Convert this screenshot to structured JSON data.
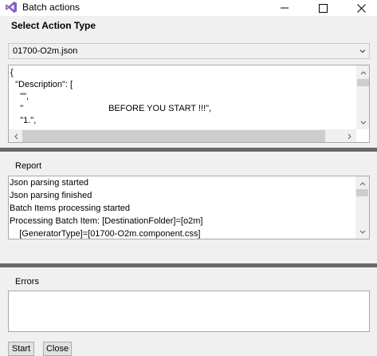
{
  "window": {
    "title": "Batch actions",
    "app_icon": "visual-studio-icon",
    "controls": [
      "minimize-icon",
      "maximize-icon",
      "close-icon"
    ]
  },
  "select_action": {
    "heading": "Select Action Type",
    "selected_value": "01700-O2m.json"
  },
  "json_editor": {
    "lines": [
      "{",
      "  \"Description\": [",
      "    \"\",",
      "    \"                                   BEFORE YOU START !!!\",",
      "    \"1.\","
    ]
  },
  "report": {
    "label": "Report",
    "lines": [
      "Json parsing started",
      "Json parsing finished",
      "Batch Items processing started",
      "Processing Batch Item: [DestinationFolder]=[o2m]",
      "    [GeneratorType]=[01700-O2m.component.css]"
    ]
  },
  "errors": {
    "label": "Errors",
    "value": ""
  },
  "buttons": {
    "start": "Start",
    "close": "Close"
  }
}
